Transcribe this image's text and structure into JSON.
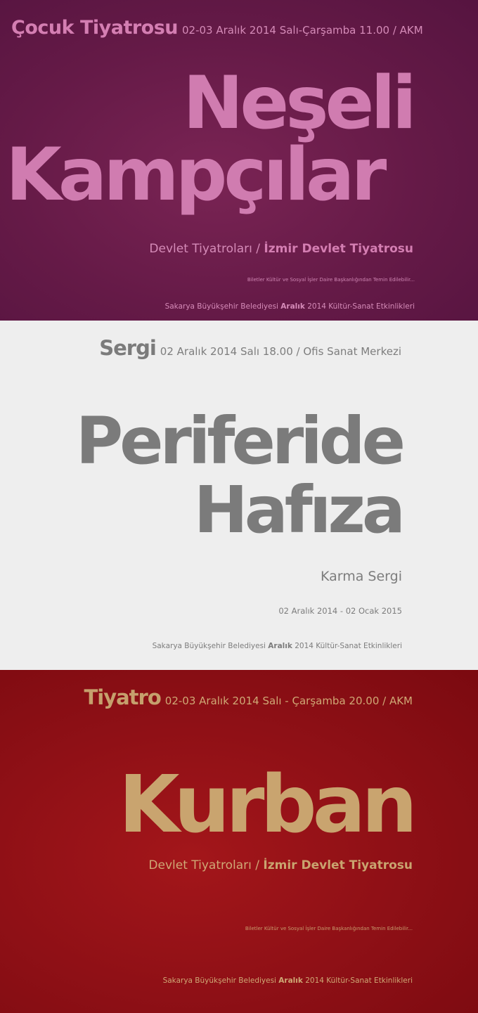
{
  "panels": [
    {
      "category": "Çocuk Tiyatrosu",
      "info": "02-03 Aralık 2014 Salı-Çarşamba 11.00 / AKM",
      "title_line1": "Neşeli",
      "title_line2": "Kampçılar",
      "company_prefix": "Devlet Tiyatroları / ",
      "company_bold": "İzmir Devlet Tiyatrosu",
      "tickets": "Biletler Kültür ve Sosyal İşler Daire Başkanlığından Temin Edilebilir...",
      "footer_prefix": "Sakarya Büyükşehir Belediyesi ",
      "footer_bold": "Aralık",
      "footer_suffix": " 2014 Kültür-Sanat Etkinlikleri"
    },
    {
      "category": "Sergi",
      "info": "02 Aralık 2014 Salı 18.00 / Ofis Sanat Merkezi",
      "title_line1": "Periferide",
      "title_line2": "Hafıza",
      "subtitle": "Karma Sergi",
      "date_range": "02 Aralık 2014 - 02 Ocak 2015",
      "footer_prefix": "Sakarya Büyükşehir Belediyesi ",
      "footer_bold": "Aralık",
      "footer_suffix": " 2014 Kültür-Sanat Etkinlikleri"
    },
    {
      "category": "Tiyatro",
      "info": "02-03 Aralık 2014 Salı - Çarşamba 20.00 / AKM",
      "title_line1": "Kurban",
      "company_prefix": "Devlet Tiyatroları / ",
      "company_bold": "İzmir Devlet Tiyatrosu",
      "tickets": "Biletler Kültür ve Sosyal İşler Daire Başkanlığından Temin Edilebilir...",
      "footer_prefix": "Sakarya Büyükşehir Belediyesi ",
      "footer_bold": "Aralık",
      "footer_suffix": " 2014 Kültür-Sanat Etkinlikleri"
    }
  ],
  "colors": {
    "panel1_bg": "#651a47",
    "panel1_text": "#d07cb0",
    "panel2_bg": "#eeeeee",
    "panel2_text": "#7b7b7b",
    "panel3_bg": "#8f1016",
    "panel3_text": "#c9a46f"
  }
}
